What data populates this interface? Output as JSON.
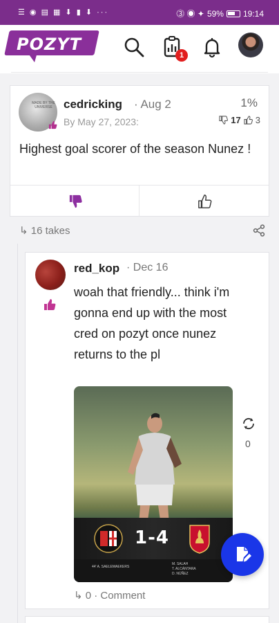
{
  "status_bar": {
    "left_icons": "☰ ◉ ▤ ▦ ⬇ ▮ ⬇ ···",
    "battery": "59%",
    "time": "19:14"
  },
  "header": {
    "logo": "POZYT",
    "notification_badge": "1"
  },
  "post": {
    "avatar_text": "MADE BY THE UNIVERSE",
    "username": "cedricking",
    "date": "· Aug 2",
    "due": "By May 27, 2023:",
    "percent": "1%",
    "dislikes": "17",
    "likes": "3",
    "text": "Highest goal scorer of the season Nunez !"
  },
  "takes": {
    "label": "↳ 16 takes"
  },
  "reply": {
    "username": "red_kop",
    "date": "· Dec 16",
    "text": "woah that friendly... think i'm gonna end up with the most cred on pozyt once nunez returns to the pl",
    "media": {
      "score": "1-4",
      "home_scorers": "44' A. SAELEMAEKERS",
      "away_scorers": "M. SALAH\nT. ALCÁNTARA\nD. NÚÑEZ"
    },
    "refresh_count": "0",
    "footer": "↳ 0 · Comment"
  },
  "colors": {
    "brand": "#8a2f9a",
    "fab": "#1a36e8",
    "badge": "#e21e1e",
    "status_bar": "#7b2d8b"
  }
}
